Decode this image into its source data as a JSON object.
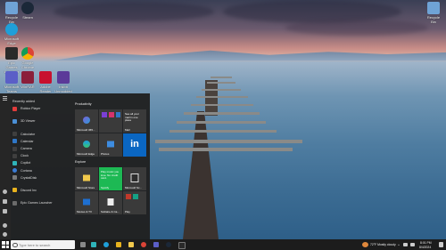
{
  "desktop": {
    "icons": [
      {
        "label": "Recycle Bin",
        "color": "#6fa3d6"
      },
      {
        "label": "Steam",
        "color": "#1b2838"
      },
      {
        "label": "Microsoft Edge",
        "color": "#1f9fd9"
      },
      {
        "label": "Epic Games Launcher",
        "color": "#2a2a2a"
      },
      {
        "label": "Google Chrome",
        "color": "#db4437"
      },
      {
        "label": "Microsoft Teams",
        "color": "#5b5fc7"
      },
      {
        "label": "WinRAR",
        "color": "#8b1f3a"
      },
      {
        "label": "Adobe Reader",
        "color": "#c8102e"
      },
      {
        "label": "Inkbit Unmodded",
        "color": "#5b3a99"
      }
    ],
    "top_right_icon": {
      "label": "Recycle Bin",
      "color": "#6fa3d6"
    }
  },
  "start_menu": {
    "recently_added_header": "Recently added",
    "recently_added": [
      {
        "label": "Roblox Player",
        "color": "#e23c3c"
      }
    ],
    "apps": [
      {
        "label": "3D Viewer",
        "color": "#4a8fd6"
      },
      {
        "label": "Calculator",
        "color": "#3f3f3f"
      },
      {
        "label": "Calendar",
        "color": "#2f77c7"
      },
      {
        "label": "Camera",
        "color": "#3f3f3f"
      },
      {
        "label": "Clock",
        "color": "#3f3f3f"
      },
      {
        "label": "Copilot",
        "color": "#2fb3b9"
      },
      {
        "label": "Cortana",
        "color": "#3a7bd5"
      },
      {
        "label": "CrystalDisk",
        "color": "#7a7a7a"
      },
      {
        "label": "Discord Inc",
        "color": "#e8b21e"
      },
      {
        "label": "Epic Games Launcher",
        "color": "#6b6b6b"
      }
    ],
    "productivity_header": "Productivity",
    "explore_header": "Explore",
    "tiles": {
      "m365": "Microsoft 365...",
      "mail": "Mail",
      "mail_text": "See all your mail in one place",
      "edge": "Microsoft Edge",
      "photos": "Photos",
      "linkedin": "in",
      "store": "Microsoft Store",
      "spotify_text": "Play music you love. No credit card.",
      "spotify": "Spotify",
      "solitaire": "Microsoft Sc...",
      "movies": "Movies & TV",
      "solitaire2": "Solitaire & Ca...",
      "play": "Play"
    }
  },
  "taskbar": {
    "search_placeholder": "Type here to search",
    "weather": "72°F  Mostly cloudy",
    "time": "8:01 PM",
    "date": "8/4/2024",
    "colors": {
      "accent": "#0078d4",
      "spotify": "#1db954",
      "linkedin": "#0a66c2"
    }
  }
}
